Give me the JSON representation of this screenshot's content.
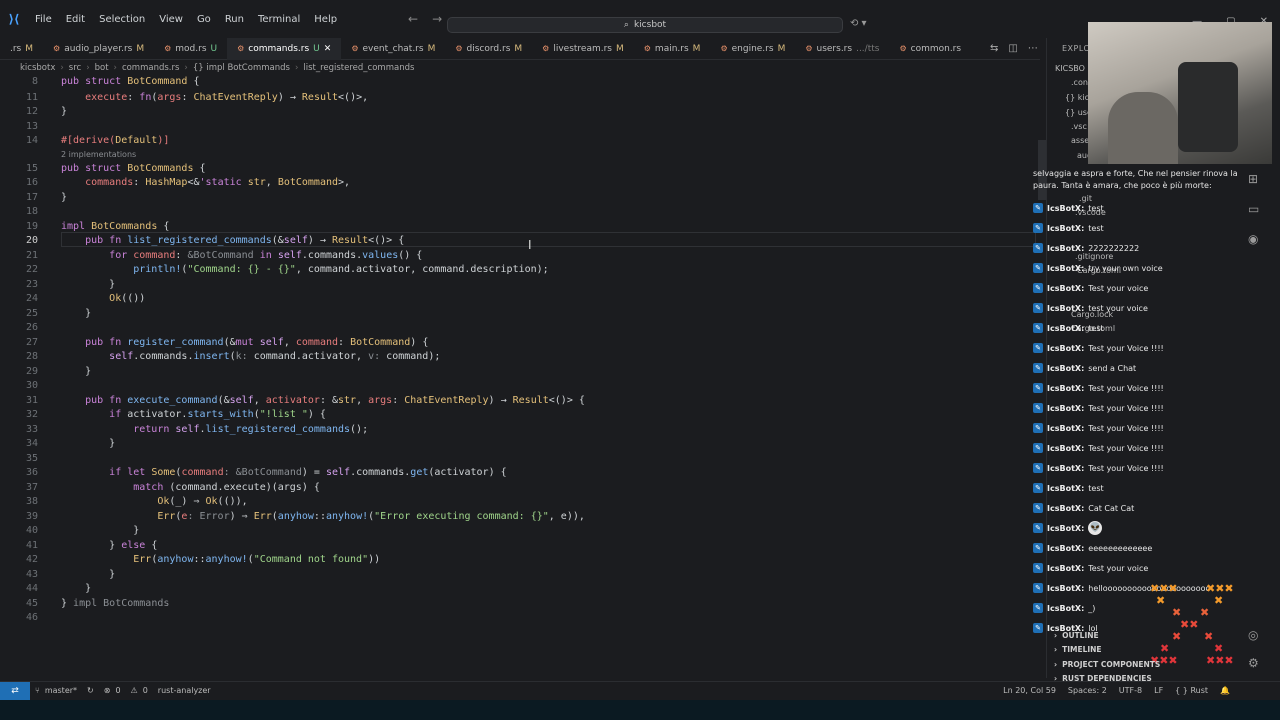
{
  "menu": [
    "File",
    "Edit",
    "Selection",
    "View",
    "Go",
    "Run",
    "Terminal",
    "Help"
  ],
  "search": {
    "text": "kicsbot"
  },
  "tabs": [
    {
      "name": ".rs",
      "status": "M",
      "active": false
    },
    {
      "name": "audio_player.rs",
      "status": "M",
      "active": false
    },
    {
      "name": "mod.rs",
      "status": "U",
      "active": false
    },
    {
      "name": "commands.rs",
      "status": "U",
      "active": true
    },
    {
      "name": "event_chat.rs",
      "status": "M",
      "active": false
    },
    {
      "name": "discord.rs",
      "status": "M",
      "active": false
    },
    {
      "name": "livestream.rs",
      "status": "M",
      "active": false
    },
    {
      "name": "main.rs",
      "status": "M",
      "active": false
    },
    {
      "name": "engine.rs",
      "status": "M",
      "active": false
    },
    {
      "name": "users.rs",
      "status": ".../tts",
      "active": false
    },
    {
      "name": "common.rs",
      "status": "",
      "active": false
    }
  ],
  "breadcrumb": [
    "kicsbotx",
    "src",
    "bot",
    "commands.rs",
    "{} impl BotCommands",
    "list_registered_commands"
  ],
  "code_lens": "2 implementations",
  "explorer": {
    "title": "EXPLOR",
    "items": [
      "KICSBO",
      ".con",
      "{} kic",
      "{} use",
      ".vsc",
      "asse",
      "aud",
      ".git",
      ".vscode",
      ".gitignore",
      "Cargo.toml",
      "Cargo.lock",
      "Cargo.toml"
    ]
  },
  "chat": {
    "header": "selvaggia e aspra e forte, Che nel pensier rinova la paura. Tanta è amara, che poco è più morte:",
    "messages": [
      {
        "user": "IcsBotX:",
        "text": "test"
      },
      {
        "user": "IcsBotX:",
        "text": "test"
      },
      {
        "user": "IcsBotX:",
        "text": "2222222222"
      },
      {
        "user": "IcsBotX:",
        "text": "try your own voice"
      },
      {
        "user": "IcsBotX:",
        "text": "Test your voice"
      },
      {
        "user": "IcsBotX:",
        "text": "test your voice"
      },
      {
        "user": "IcsBotX:",
        "text": "test"
      },
      {
        "user": "IcsBotX:",
        "text": "Test your Voice !!!!"
      },
      {
        "user": "IcsBotX:",
        "text": "send a Chat"
      },
      {
        "user": "IcsBotX:",
        "text": "Test your Voice !!!!"
      },
      {
        "user": "IcsBotX:",
        "text": "Test your Voice !!!!"
      },
      {
        "user": "IcsBotX:",
        "text": "Test your Voice !!!!"
      },
      {
        "user": "IcsBotX:",
        "text": "Test your Voice !!!!"
      },
      {
        "user": "IcsBotX:",
        "text": "Test your Voice !!!!"
      },
      {
        "user": "IcsBotX:",
        "text": "test"
      },
      {
        "user": "IcsBotX:",
        "text": "Cat Cat Cat"
      },
      {
        "user": "IcsBotX:",
        "text": ""
      },
      {
        "user": "IcsBotX:",
        "text": "eeeeeeeeeeeee"
      },
      {
        "user": "IcsBotX:",
        "text": "Test your voice"
      },
      {
        "user": "IcsBotX:",
        "text": "helloooooooooooooooooooooo"
      },
      {
        "user": "IcsBotX:",
        "text": "_)"
      },
      {
        "user": "IcsBotX:",
        "text": "lol"
      }
    ]
  },
  "panel_sections": [
    "OUTLINE",
    "TIMELINE",
    "PROJECT COMPONENTS",
    "RUST DEPENDENCIES"
  ],
  "status": {
    "branch": "master*",
    "problems": "0",
    "warnings": "0",
    "analyzer": "rust-analyzer",
    "position": "Ln 20, Col 59",
    "spaces": "Spaces: 2",
    "encoding": "UTF-8",
    "eol": "LF",
    "language": "Rust"
  },
  "colors": {
    "accent": "#1f6fb5",
    "keyword": "#c983d8",
    "type": "#e4c07a",
    "function": "#7fb6f0",
    "string": "#9fd48a"
  }
}
